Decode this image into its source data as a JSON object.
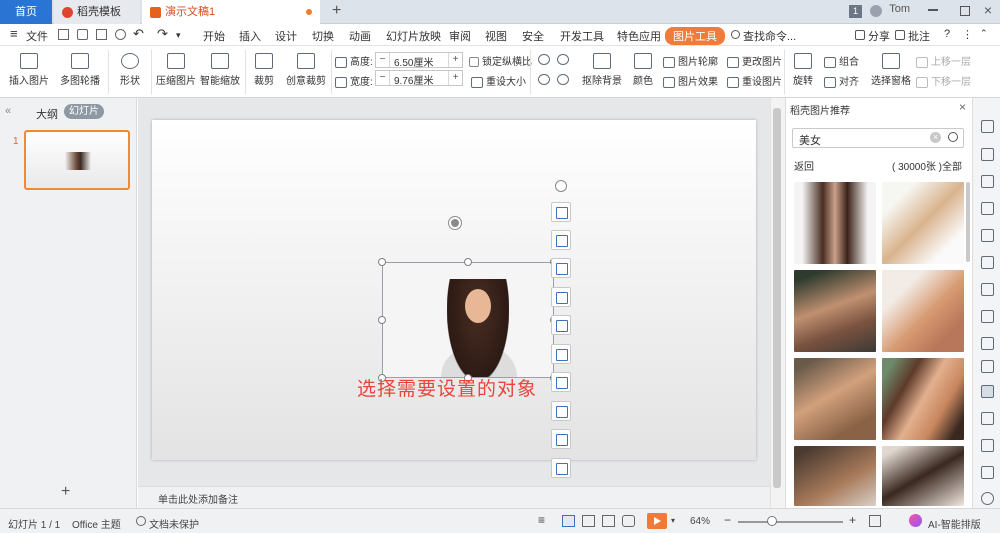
{
  "tabs": {
    "home": "首页",
    "template": "稻壳模板",
    "document": "演示文稿1",
    "new_tab": "+"
  },
  "window": {
    "badge": "1",
    "user": "Tom"
  },
  "menu": {
    "file": "文件",
    "items": [
      "开始",
      "插入",
      "设计",
      "切换",
      "动画",
      "幻灯片放映",
      "审阅",
      "视图",
      "安全",
      "开发工具",
      "特色应用"
    ],
    "active": "图片工具",
    "search": "查找命令...",
    "share": "分享",
    "comment": "批注"
  },
  "ribbon": {
    "insert_pic": "插入图片",
    "multi_outline": "多图轮播",
    "shape": "形状",
    "compress": "压缩图片",
    "smart_zoom": "智能缩放",
    "crop": "裁剪",
    "creative_crop": "创意裁剪",
    "height_label": "高度:",
    "height_value": "6.50厘米",
    "width_label": "宽度:",
    "width_value": "9.76厘米",
    "lock_ratio": "锁定纵横比",
    "reset_size": "重设大小",
    "remove_bg": "抠除背景",
    "color": "颜色",
    "pic_outline": "图片轮廓",
    "pic_effect": "图片效果",
    "change_pic": "更改图片",
    "reset_pic": "重设图片",
    "rotate": "旋转",
    "group": "组合",
    "align": "对齐",
    "selection_pane": "选择窗格",
    "bring_forward": "上移一层",
    "send_backward": "下移一层"
  },
  "left": {
    "outline": "大纲",
    "slides": "幻灯片",
    "slide_number": "1",
    "add_slide": "+"
  },
  "canvas": {
    "caption": "选择需要设置的对象",
    "notes": "单击此处添加备注"
  },
  "right": {
    "title": "稻壳图片推荐",
    "search_value": "美女",
    "back": "返回",
    "count": "( 30000张 )全部"
  },
  "status": {
    "slide": "幻灯片 1 / 1",
    "theme": "Office 主题",
    "protect": "文档未保护",
    "zoom": "64%",
    "ai": "AI-智能排版"
  },
  "colors": {
    "accent": "#2a74d4",
    "orange": "#f07d2c",
    "caption": "#e8453c"
  }
}
